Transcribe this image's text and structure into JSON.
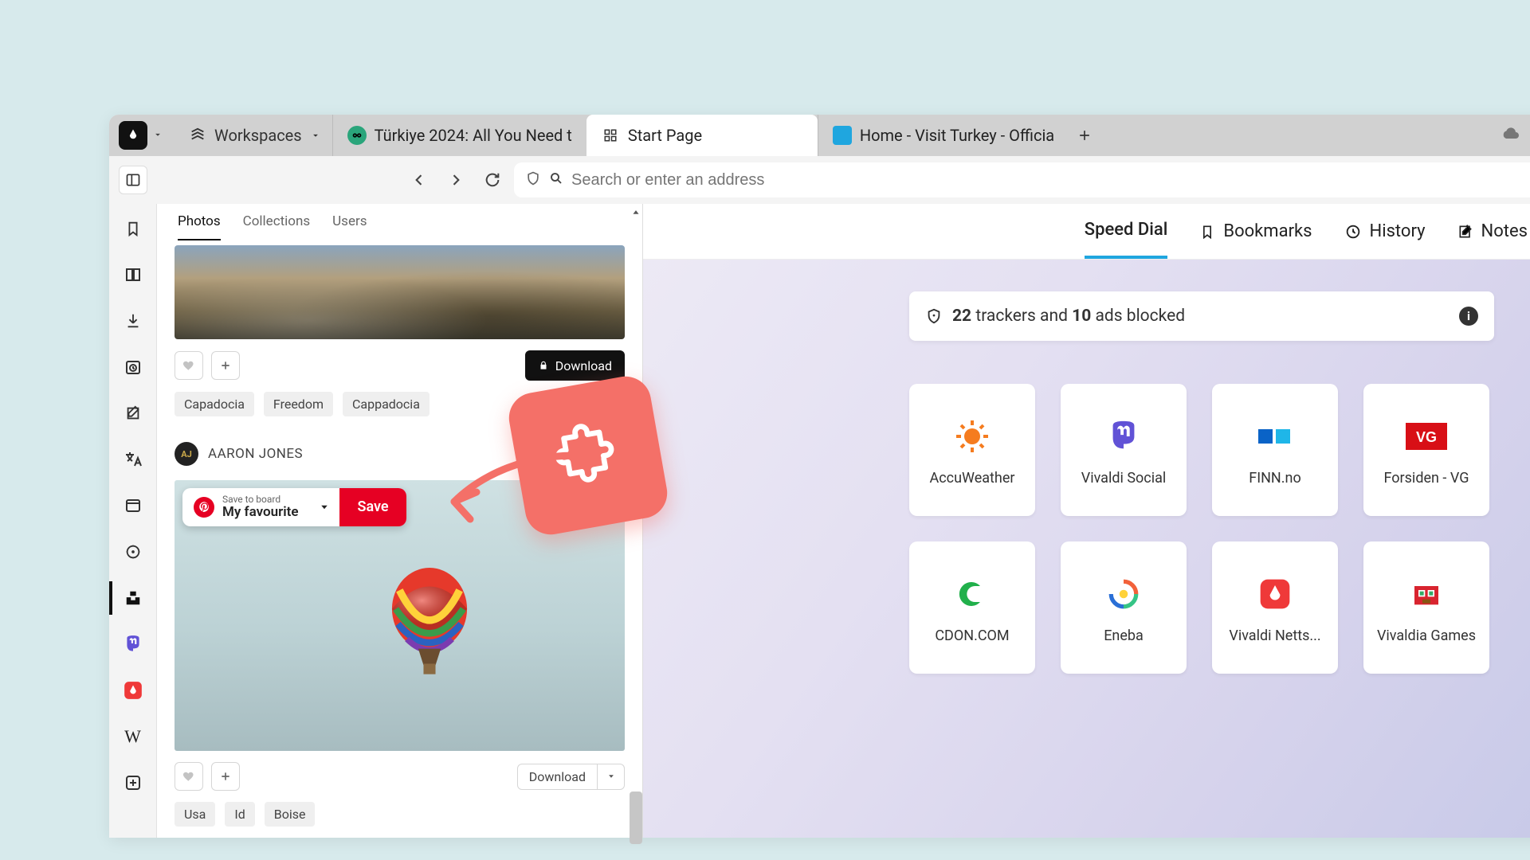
{
  "tabbar": {
    "workspaces_label": "Workspaces",
    "tabs": [
      {
        "label": "Türkiye 2024: All You Need t",
        "favicon": "tripadvisor"
      },
      {
        "label": "Start Page",
        "favicon": "grid"
      },
      {
        "label": "Home - Visit Turkey - Officia",
        "favicon": "turkey"
      }
    ]
  },
  "address": {
    "placeholder": "Search or enter an address"
  },
  "startpage_tabs": {
    "speed_dial": "Speed Dial",
    "bookmarks": "Bookmarks",
    "history": "History",
    "notes": "Notes"
  },
  "tracker": {
    "count": "22",
    "word1": "trackers and",
    "adcount": "10",
    "word2": "ads blocked"
  },
  "dials": [
    {
      "label": "AccuWeather"
    },
    {
      "label": "Vivaldi Social"
    },
    {
      "label": "FINN.no"
    },
    {
      "label": "Forsiden - VG"
    },
    {
      "label": "CDON.COM"
    },
    {
      "label": "Eneba"
    },
    {
      "label": "Vivaldi Netts..."
    },
    {
      "label": "Vivaldia Games"
    }
  ],
  "panel": {
    "tabs": {
      "photos": "Photos",
      "collections": "Collections",
      "users": "Users"
    },
    "download": "Download",
    "tags1": [
      "Capadocia",
      "Freedom",
      "Cappadocia"
    ],
    "author": "AARON JONES",
    "pinterest": {
      "saveto": "Save to board",
      "board": "My favourite",
      "save": "Save"
    },
    "download2": "Download",
    "tags2": [
      "Usa",
      "Id",
      "Boise"
    ]
  }
}
